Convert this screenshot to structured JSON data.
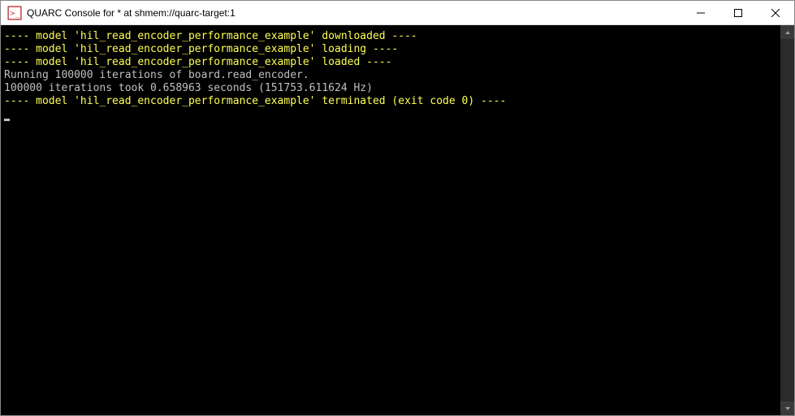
{
  "window": {
    "title": "QUARC Console for * at shmem://quarc-target:1"
  },
  "console": {
    "lines": [
      {
        "cls": "y",
        "text": "---- model 'hil_read_encoder_performance_example' downloaded ----"
      },
      {
        "cls": "y",
        "text": "---- model 'hil_read_encoder_performance_example' loading ----"
      },
      {
        "cls": "y",
        "text": "---- model 'hil_read_encoder_performance_example' loaded ----"
      },
      {
        "cls": "w",
        "text": ""
      },
      {
        "cls": "w",
        "text": "Running 100000 iterations of board.read_encoder."
      },
      {
        "cls": "w",
        "text": "100000 iterations took 0.658963 seconds (151753.611624 Hz)"
      },
      {
        "cls": "w",
        "text": ""
      },
      {
        "cls": "w",
        "text": ""
      },
      {
        "cls": "y",
        "text": "---- model 'hil_read_encoder_performance_example' terminated (exit code 0) ----"
      },
      {
        "cls": "w",
        "text": ""
      }
    ]
  }
}
